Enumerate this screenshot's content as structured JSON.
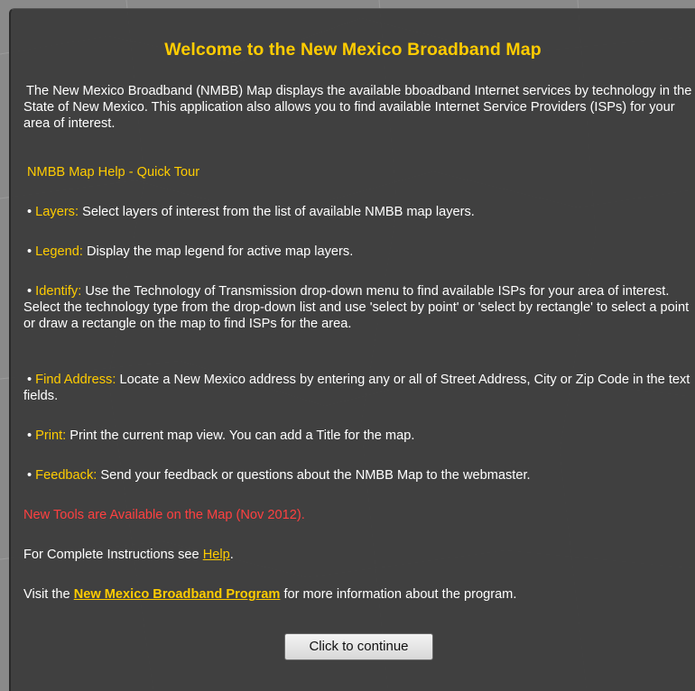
{
  "dialog": {
    "title": "Welcome to the New Mexico Broadband Map",
    "intro": "The New Mexico Broadband (NMBB) Map displays the available bboadband Internet services by technology in the State of New Mexico. This application also allows you to find available Internet Service Providers (ISPs) for your area of interest.",
    "quick_tour_heading": "NMBB Map Help - Quick Tour",
    "items": [
      {
        "label": "Layers:",
        "text": " Select layers of interest from the list of available NMBB map layers."
      },
      {
        "label": "Legend:",
        "text": " Display the map legend for active map layers."
      },
      {
        "label": "Identify:",
        "text": " Use the Technology of Transmission drop-down menu to find available ISPs for your area of interest.",
        "extra": "Select the technology type from the drop-down list and use 'select by point' or 'select by rectangle' to select a point or draw a rectangle on the map to find ISPs for the area."
      },
      {
        "label": "Find Address:",
        "text": " Locate a New Mexico address by entering any or all of Street Address, City or Zip Code in the text fields."
      },
      {
        "label": "Print:",
        "text": " Print the current map view. You can add a Title for the map."
      },
      {
        "label": "Feedback:",
        "text": " Send your feedback or questions about the NMBB Map to the webmaster."
      }
    ],
    "new_tools_notice": "New Tools are Available on the Map (Nov 2012).",
    "complete_instructions_prefix": "For Complete Instructions see ",
    "help_link": "Help",
    "complete_instructions_suffix": ".",
    "visit_prefix": "Visit the ",
    "program_link": "New Mexico Broadband Program",
    "visit_suffix": " for more information about the program.",
    "continue_button": "Click to continue"
  },
  "colors": {
    "title": "#ffcc00",
    "highlight": "#ffcc00",
    "notice": "#ff4040",
    "dialog_bg": "#3a3a3a"
  }
}
